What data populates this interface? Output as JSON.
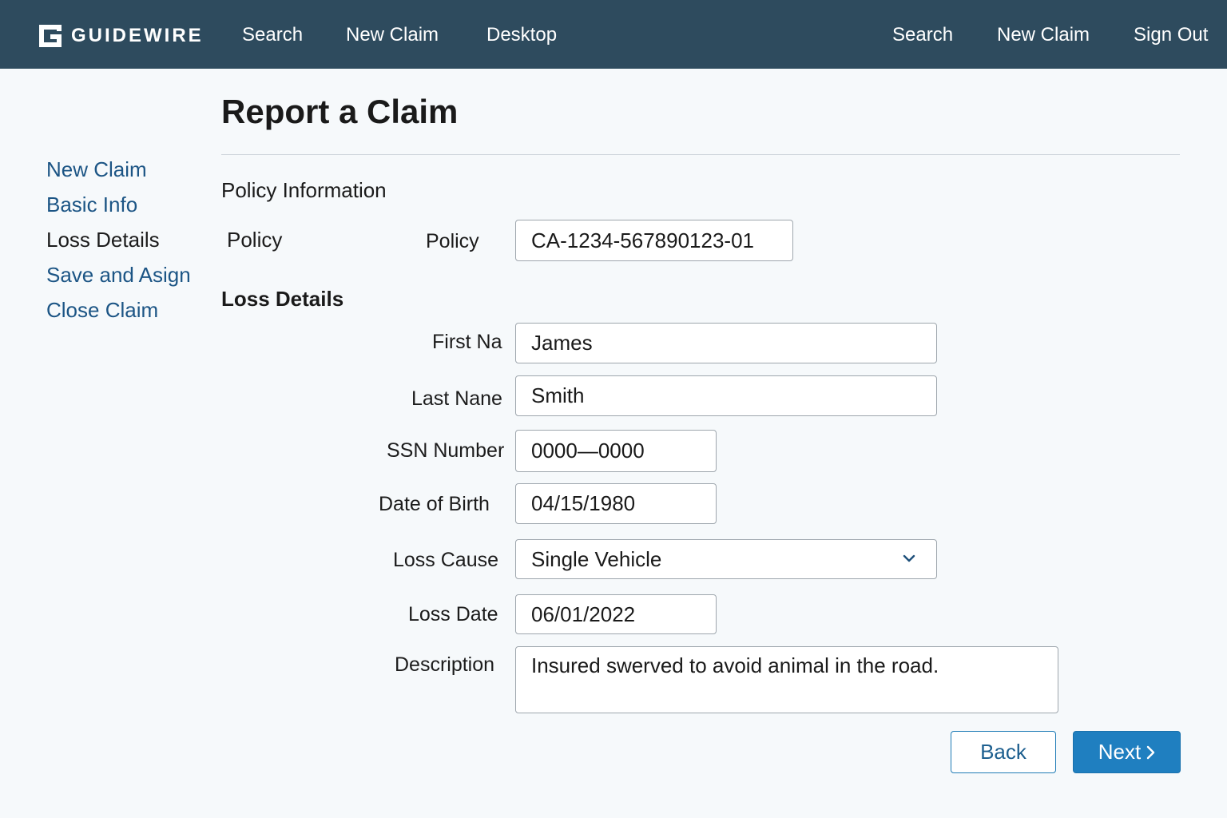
{
  "header": {
    "brand": "GUIDEWIRE",
    "nav_left": [
      "Search",
      "New Claim",
      "Desktop"
    ],
    "nav_right": [
      "Search",
      "New Claim",
      "Sign Out"
    ]
  },
  "sidebar": {
    "items": [
      {
        "label": "New Claim",
        "active": false
      },
      {
        "label": "Basic Info",
        "active": false
      },
      {
        "label": "Loss Details",
        "active": true
      },
      {
        "label": "Save and Asign",
        "active": false
      },
      {
        "label": "Close Claim",
        "active": false
      }
    ]
  },
  "page": {
    "title": "Report a Claim"
  },
  "policy_section": {
    "heading": "Policy Information",
    "left_label": "Policy",
    "field_label": "Policy",
    "policy_value": "CA-1234-567890123-01"
  },
  "loss_section": {
    "heading": "Loss Details",
    "fields": {
      "first_name": {
        "label": "First Na",
        "value": "James"
      },
      "last_name": {
        "label": "Last Nane",
        "value": "Smith"
      },
      "ssn": {
        "label": "SSN Number",
        "value": "0000—0000"
      },
      "dob": {
        "label": "Date of Birth",
        "value": "04/15/1980"
      },
      "loss_cause": {
        "label": "Loss Cause",
        "value": "Single Vehicle"
      },
      "loss_date": {
        "label": "Loss Date",
        "value": "06/01/2022"
      },
      "description": {
        "label": "Description",
        "value": "Insured swerved to avoid animal in the road."
      }
    }
  },
  "actions": {
    "back_label": "Back",
    "next_label": "Next"
  },
  "colors": {
    "header_bg": "#2e4b5e",
    "link": "#1c5585",
    "primary_button": "#1f7fc0"
  }
}
